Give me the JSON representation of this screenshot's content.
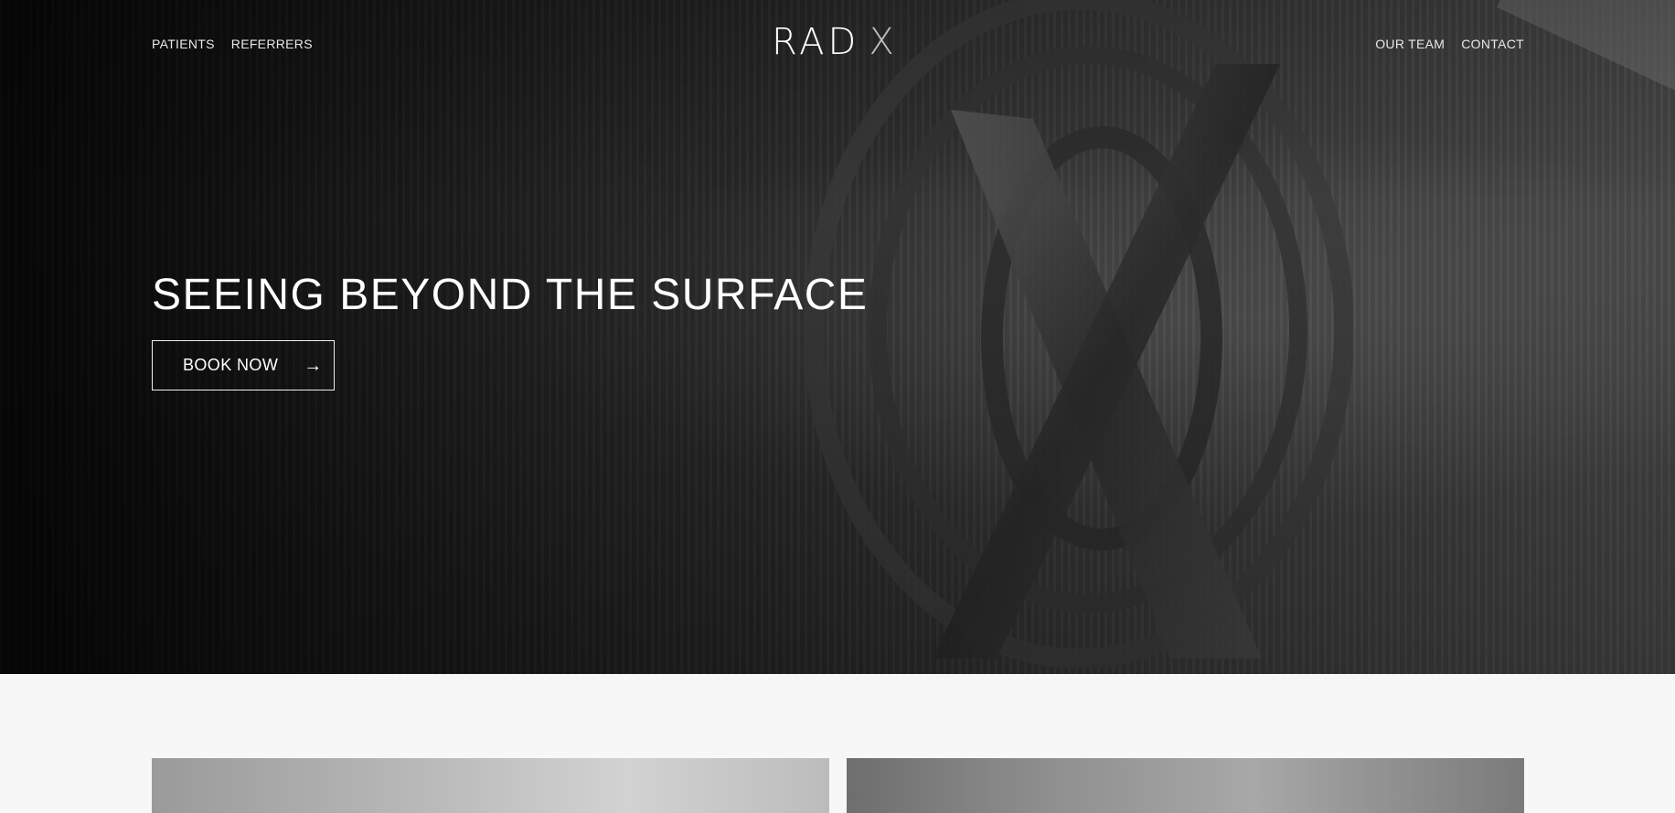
{
  "nav": {
    "left": [
      {
        "label": "PATIENTS"
      },
      {
        "label": "REFERRERS"
      }
    ],
    "right": [
      {
        "label": "OUR TEAM"
      },
      {
        "label": "CONTACT"
      }
    ]
  },
  "logo": {
    "text": "RAD",
    "mark": "X"
  },
  "hero": {
    "headline": "SEEING BEYOND THE SURFACE",
    "cta_label": "BOOK NOW",
    "cta_icon": "arrow-right-icon"
  },
  "colors": {
    "hero_bg": "#2a2a2a",
    "text": "#ffffff",
    "page_bg": "#f7f7f7"
  }
}
